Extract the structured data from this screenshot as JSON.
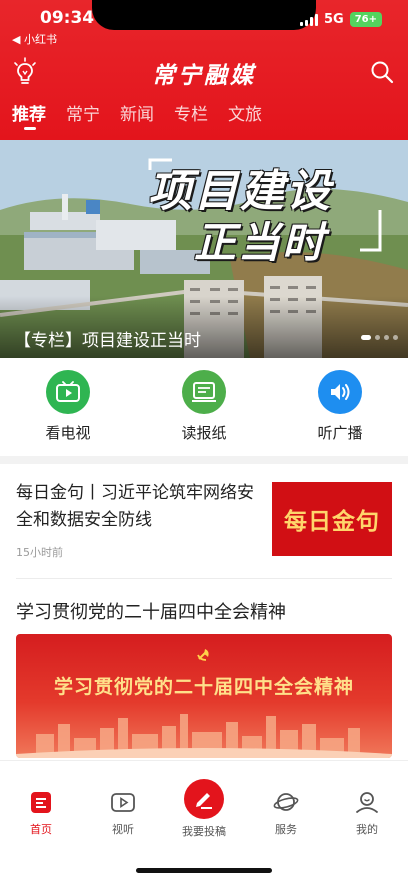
{
  "status_bar": {
    "time": "09:34",
    "back_label": "◀ 小红书",
    "network": "5G",
    "battery": "76+"
  },
  "header": {
    "app_title": "常宁融媒",
    "tabs": [
      {
        "label": "推荐",
        "active": true
      },
      {
        "label": "常宁",
        "active": false
      },
      {
        "label": "新闻",
        "active": false
      },
      {
        "label": "专栏",
        "active": false
      },
      {
        "label": "文旅",
        "active": false
      }
    ]
  },
  "banner": {
    "headline_line1": "项目建设",
    "headline_line2": "正当时",
    "caption": "【专栏】项目建设正当时"
  },
  "quick_actions": [
    {
      "label": "看电视",
      "icon": "tv-icon",
      "color": "#2fb552"
    },
    {
      "label": "读报纸",
      "icon": "newspaper-icon",
      "color": "#4dae4a"
    },
    {
      "label": "听广播",
      "icon": "speaker-icon",
      "color": "#1e8ef0"
    }
  ],
  "news": [
    {
      "title": "每日金句丨习近平论筑牢网络安全和数据安全防线",
      "time": "15小时前",
      "thumb_text": "每日金句"
    }
  ],
  "feature": {
    "title": "学习贯彻党的二十届四中全会精神",
    "banner_text": "学习贯彻党的二十届四中全会精神"
  },
  "bottom_nav": [
    {
      "label": "首页",
      "icon": "home-icon",
      "active": true
    },
    {
      "label": "视听",
      "icon": "play-icon",
      "active": false
    },
    {
      "label": "我要投稿",
      "icon": "post-icon",
      "active": false
    },
    {
      "label": "服务",
      "icon": "planet-icon",
      "active": false
    },
    {
      "label": "我的",
      "icon": "user-icon",
      "active": false
    }
  ],
  "colors": {
    "brand_red": "#e3141c",
    "tv_green": "#2fb552",
    "paper_green": "#4dae4a",
    "radio_blue": "#1e8ef0"
  }
}
